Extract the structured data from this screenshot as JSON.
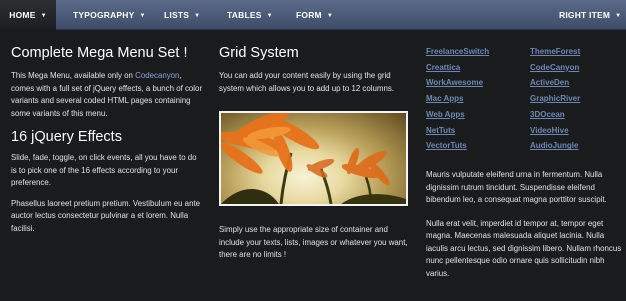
{
  "menu": {
    "items": [
      {
        "label": "HOME",
        "caret": "▼"
      },
      {
        "label": "TYPOGRAPHY",
        "caret": "▼"
      },
      {
        "label": "LISTS",
        "caret": "▼"
      },
      {
        "label": "TABLES",
        "caret": "▼"
      },
      {
        "label": "FORM",
        "caret": "▼"
      }
    ],
    "right_item": {
      "label": "RIGHT ITEM",
      "caret": "▼"
    }
  },
  "col1": {
    "heading1": "Complete Mega Menu Set !",
    "p1_before": "This Mega Menu, available only on ",
    "p1_link": "Codecanyon",
    "p1_after": ", comes with a full set of jQuery effects, a bunch of color variants and several coded HTML pages containing some variants of this menu.",
    "heading2": "16 jQuery Effects",
    "p2": "Slide, fade, toggle, on click events, all you have to do is to pick one of the 16 effects according to your preference.",
    "p3": "Phasellus laoreet pretium pretium. Vestibulum eu ante auctor lectus consectetur pulvinar a et lorem. Nulla facilisi."
  },
  "col2": {
    "heading": "Grid System",
    "p1": "You can add your content easily by using the grid system which allows you to add up to 12 columns.",
    "p2": "Simply use the appropriate size of container and include your texts, lists, images or whatever you want, there are no limits !"
  },
  "col3": {
    "links_left": [
      "FreelanceSwitch",
      "Creattica",
      "WorkAwesome",
      "Mac Apps",
      "Web Apps",
      "NetTuts",
      "VectorTuts"
    ],
    "links_right": [
      "ThemeForest",
      "CodeCanyon",
      "ActiveDen",
      "GraphicRiver",
      "3DOcean",
      "VideoHive",
      "AudioJungle"
    ],
    "p1": "Mauris vulputate eleifend urna in fermentum. Nulla dignissim rutrum tincidunt. Suspendisse eleifend bibendum leo, a consequat magna porttitor suscipit.",
    "p2": "Nulla erat velit, imperdiet id tempor at, tempor eget magna. Maecenas malesuada aliquet lacinia. Nulla iaculis arcu lectus, sed dignissim libero. Nullam rhoncus nunc pellentesque odio ornare quis sollicitudin nibh varius."
  },
  "colors": {
    "menubar": "#4d5c7a",
    "panel": "#1a1b1c",
    "link": "#6f87b6",
    "inline_link": "#8ea5d8"
  },
  "icons": {
    "caret": "caret-down-icon"
  }
}
